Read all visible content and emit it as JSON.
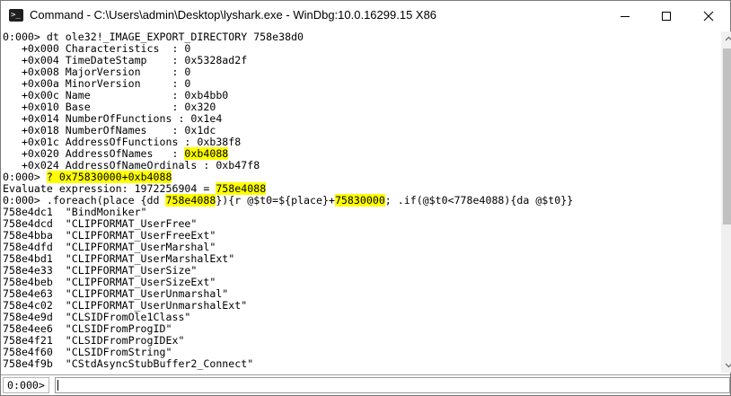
{
  "window": {
    "title": "Command - C:\\Users\\admin\\Desktop\\lyshark.exe - WinDbg:10.0.16299.15 X86"
  },
  "icons": {
    "app": "console-icon",
    "minimize": "minimize-icon",
    "maximize": "maximize-icon",
    "close": "close-icon",
    "app_glyph": ">_"
  },
  "output": [
    [
      "0:000> dt ole32!_IMAGE_EXPORT_DIRECTORY 758e38d0"
    ],
    [
      "   +0x000 Characteristics  : 0"
    ],
    [
      "   +0x004 TimeDateStamp    : 0x5328ad2f"
    ],
    [
      "   +0x008 MajorVersion     : 0"
    ],
    [
      "   +0x00a MinorVersion     : 0"
    ],
    [
      "   +0x00c Name             : 0xb4bb0"
    ],
    [
      "   +0x010 Base             : 0x320"
    ],
    [
      "   +0x014 NumberOfFunctions : 0x1e4"
    ],
    [
      "   +0x018 NumberOfNames    : 0x1dc"
    ],
    [
      "   +0x01c AddressOfFunctions : 0xb38f8"
    ],
    [
      "   +0x020 AddressOfNames   : ",
      {
        "h": "0xb4088"
      }
    ],
    [
      "   +0x024 AddressOfNameOrdinals : 0xb47f8"
    ],
    [
      "0:000> ",
      {
        "h": "? 0x75830000+0xb4088"
      }
    ],
    [
      "Evaluate expression: 1972256904 = ",
      {
        "h": "758e4088"
      }
    ],
    [
      "0:000> .foreach(place {dd ",
      {
        "h": "758e4088"
      },
      "}){r @$t0=${place}+",
      {
        "h": "75830000"
      },
      "; .if(@$t0<778e4088){da @$t0}}"
    ],
    [
      "758e4dc1  \"BindMoniker\""
    ],
    [
      "758e4dcd  \"CLIPFORMAT_UserFree\""
    ],
    [
      "758e4bba  \"CLIPFORMAT_UserFreeExt\""
    ],
    [
      "758e4dfd  \"CLIPFORMAT_UserMarshal\""
    ],
    [
      "758e4bd1  \"CLIPFORMAT_UserMarshalExt\""
    ],
    [
      "758e4e33  \"CLIPFORMAT_UserSize\""
    ],
    [
      "758e4beb  \"CLIPFORMAT_UserSizeExt\""
    ],
    [
      "758e4e63  \"CLIPFORMAT_UserUnmarshal\""
    ],
    [
      "758e4c02  \"CLIPFORMAT_UserUnmarshalExt\""
    ],
    [
      "758e4e9d  \"CLSIDFromOle1Class\""
    ],
    [
      "758e4ee6  \"CLSIDFromProgID\""
    ],
    [
      "758e4f21  \"CLSIDFromProgIDEx\""
    ],
    [
      "758e4f60  \"CLSIDFromString\""
    ],
    [
      "758e4f9b  \"CStdAsyncStubBuffer2_Connect\""
    ]
  ],
  "command": {
    "prompt": "0:000>",
    "value": ""
  },
  "colors": {
    "highlight": "#ffff00",
    "scroll_track": "#f0f0f0",
    "scroll_thumb": "#c1c1c1"
  }
}
